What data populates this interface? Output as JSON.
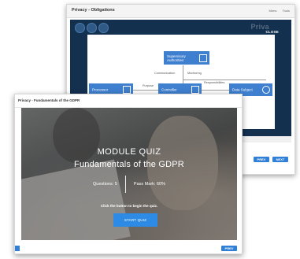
{
  "back_window": {
    "title": "Privacy - Obligations",
    "top_nav": [
      "Menu",
      "Tools"
    ],
    "brand_faint": "Priva",
    "close_label": "CLOSE",
    "diagram": {
      "nodes": {
        "supervisory": "Supervisory Authorities",
        "processor": "Processor",
        "controller": "Controller",
        "data_subject": "Data Subject"
      },
      "edges": {
        "communication": "Communication",
        "monitoring": "Monitoring",
        "responsibilities": "Responsibilities",
        "purpose": "Purpose",
        "means": "Means"
      }
    },
    "prev_label": "PREV",
    "next_label": "NEXT"
  },
  "front_window": {
    "title": "Privacy - Fundamentals of the GDPR",
    "quiz": {
      "heading": "MODULE QUIZ",
      "subheading": "Fundamentals of the GDPR",
      "questions": "Questions: 5",
      "pass_mark": "Pass Mark: 60%",
      "hint": "Click the button to begin the quiz.",
      "start_label": "START QUIZ"
    },
    "prev_label": "PREV"
  },
  "colors": {
    "accent_blue": "#2d8be6",
    "node_blue": "#3f7fcf",
    "dark_navy": "#13304f"
  }
}
